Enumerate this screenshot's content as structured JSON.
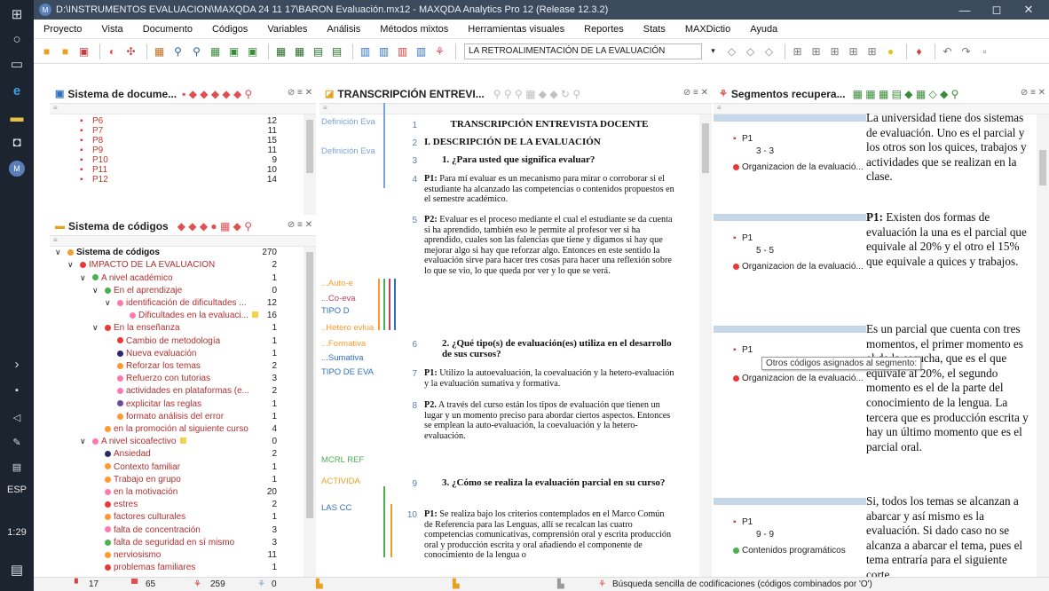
{
  "taskbar": {
    "lang": "ESP",
    "clock": "1:29"
  },
  "window": {
    "title": "D:\\INSTRUMENTOS EVALUACION\\MAXQDA 24 11 17\\BARON Evaluación.mx12 - MAXQDA Analytics Pro 12 (Release 12.3.2)"
  },
  "menu": [
    "Proyecto",
    "Vista",
    "Documento",
    "Códigos",
    "Variables",
    "Análisis",
    "Métodos mixtos",
    "Herramientas visuales",
    "Reportes",
    "Stats",
    "MAXDictio",
    "Ayuda"
  ],
  "toolbar": {
    "code_combo": "LA RETROALIMENTACIÓN DE LA EVALUACIÓN"
  },
  "doc_system": {
    "title": "Sistema de docume...",
    "rows": [
      {
        "name": "P6",
        "count": "12"
      },
      {
        "name": "P7",
        "count": "11"
      },
      {
        "name": "P8",
        "count": "15"
      },
      {
        "name": "P9",
        "count": "11"
      },
      {
        "name": "P10",
        "count": "9"
      },
      {
        "name": "P11",
        "count": "10"
      },
      {
        "name": "P12",
        "count": "14"
      }
    ]
  },
  "code_system": {
    "title": "Sistema de códigos",
    "rows": [
      {
        "label": "Sistema de códigos",
        "count": "270",
        "lvl": 0,
        "color": "#f0a030",
        "bold": true,
        "exp": "∨"
      },
      {
        "label": "IMPACTO DE LA EVALUACIÓN",
        "count": "2",
        "lvl": 1,
        "color": "#e83a3a",
        "exp": "∨",
        "red": true
      },
      {
        "label": "A nivel académico",
        "count": "1",
        "lvl": 2,
        "color": "#4caf50",
        "exp": "∨",
        "red": true
      },
      {
        "label": "En el aprendizaje",
        "count": "0",
        "lvl": 3,
        "color": "#4caf50",
        "exp": "∨",
        "red": true
      },
      {
        "label": "identificación de dificultades ...",
        "count": "12",
        "lvl": 4,
        "color": "#ff7ab0",
        "exp": "∨",
        "red": true
      },
      {
        "label": "Dificultades en la evaluaci...",
        "count": "16",
        "lvl": 5,
        "color": "#ff7ab0",
        "red": true,
        "memo": true
      },
      {
        "label": "En la enseñanza",
        "count": "1",
        "lvl": 3,
        "color": "#e83a3a",
        "exp": "∨",
        "red": true
      },
      {
        "label": "Cambio de metodología",
        "count": "1",
        "lvl": 4,
        "color": "#e83a3a",
        "red": true
      },
      {
        "label": "Nueva evaluación",
        "count": "1",
        "lvl": 4,
        "color": "#2a2a6a",
        "red": true
      },
      {
        "label": "Reforzar los temas",
        "count": "2",
        "lvl": 4,
        "color": "#ff9a30",
        "red": true
      },
      {
        "label": "Refuerzo con tutorias",
        "count": "3",
        "lvl": 4,
        "color": "#ff7ab0",
        "red": true
      },
      {
        "label": "actividades en plataformas (e...",
        "count": "2",
        "lvl": 4,
        "color": "#ff7ab0",
        "red": true
      },
      {
        "label": "explicitar las reglas",
        "count": "1",
        "lvl": 4,
        "color": "#6a4a9a",
        "red": true
      },
      {
        "label": "formato análisis del error",
        "count": "1",
        "lvl": 4,
        "color": "#ff9a30",
        "red": true
      },
      {
        "label": "en la promoción al siguiente curso",
        "count": "4",
        "lvl": 3,
        "color": "#ff9a30",
        "red": true
      },
      {
        "label": "A nivel sicoafectivo",
        "count": "0",
        "lvl": 2,
        "color": "#ff7ab0",
        "exp": "∨",
        "red": true,
        "memo": true
      },
      {
        "label": "Ansiedad",
        "count": "2",
        "lvl": 3,
        "color": "#2a2a6a",
        "red": true
      },
      {
        "label": "Contexto familiar",
        "count": "1",
        "lvl": 3,
        "color": "#ff9a30",
        "red": true
      },
      {
        "label": "Trabajo en grupo",
        "count": "1",
        "lvl": 3,
        "color": "#ff9a30",
        "red": true
      },
      {
        "label": "en la motivación",
        "count": "20",
        "lvl": 3,
        "color": "#ff7ab0",
        "red": true
      },
      {
        "label": "estres",
        "count": "2",
        "lvl": 3,
        "color": "#e83a3a",
        "red": true
      },
      {
        "label": "factores culturales",
        "count": "1",
        "lvl": 3,
        "color": "#ff9a30",
        "red": true
      },
      {
        "label": "falta de concentración",
        "count": "3",
        "lvl": 3,
        "color": "#ff7ab0",
        "red": true
      },
      {
        "label": "falta de seguridad en sí mismo",
        "count": "3",
        "lvl": 3,
        "color": "#4caf50",
        "red": true
      },
      {
        "label": "nerviosismo",
        "count": "11",
        "lvl": 3,
        "color": "#ff9a30",
        "red": true
      },
      {
        "label": "problemas familiares",
        "count": "1",
        "lvl": 3,
        "color": "#e83a3a",
        "red": true
      }
    ]
  },
  "transcript": {
    "title": "TRANSCRIPCIÓN ENTREVI...",
    "lines": [
      {
        "n": "1",
        "text": "TRANSCRIPCIÓN ENTREVISTA DOCENTE",
        "bold": true,
        "center": true
      },
      {
        "n": "2",
        "text": "I. DESCRIPCIÓN DE LA EVALUACIÓN",
        "bold": true
      },
      {
        "n": "3",
        "text": "1.  ¿Para usted que significa evaluar?",
        "bold": true,
        "indent": true
      },
      {
        "n": "4",
        "lead": "P1:",
        "text": " Para mí evaluar es un mecanismo para mirar o corroborar si el estudiante ha alcanzado las competencias o contenidos propuestos en el semestre académico."
      },
      {
        "n": "5",
        "lead": "P2:",
        "text": " Evaluar es el proceso mediante el cual el estudiante se da cuenta si ha aprendido, también eso le permite al profesor ver si ha aprendido, cuales son las falencias que tiene y digamos si hay que mejorar algo si hay que reforzar algo.  Entonces en este sentido la evaluación sirve para hacer tres cosas para hacer una reflexión sobre lo que se vio, lo que queda por ver y lo que se verá."
      },
      {
        "n": "6",
        "text": "2.  ¿Qué tipo(s) de evaluación(es) utiliza en el desarrollo de sus cursos?",
        "bold": true,
        "indent": true
      },
      {
        "n": "7",
        "lead": "P1:",
        "text": " Utilizo la autoevaluación, la coevaluación y la hetero-evaluación y la evaluación sumativa y formativa."
      },
      {
        "n": "8",
        "lead": "P2.",
        "text": " A través del curso están los tipos de evaluación que tienen un lugar y un momento preciso para abordar ciertos aspectos. Entonces se emplean la auto-evaluación, la coevaluación y la hetero-evaluación."
      },
      {
        "n": "9",
        "text": "3.  ¿Cómo se realiza la evaluación parcial en su curso?",
        "bold": true,
        "indent": true
      },
      {
        "n": "10",
        "lead": "P1:",
        "text": " Se realiza bajo los criterios contemplados en el Marco Común de Referencia para las Lenguas, allí se recalcan las cuatro competencias comunicativas, comprensión oral y escrita producción oral y producción escrita y oral añadiendo el componente de conocimiento de la lengua o"
      }
    ],
    "margin_codes": [
      "Definición Eva",
      "Definición Eva",
      "...Auto-e",
      "...Co-eva",
      "TIPO D",
      "..Hetero evlua",
      "...Formativa",
      "...Sumativa",
      "TIPO DE EVA",
      "MCRL REF",
      "ACTIVIDA",
      "LAS CC"
    ]
  },
  "segments": {
    "title": "Segmentos recupera...",
    "tooltip": "Otros códigos asignados al segmento:",
    "items": [
      {
        "doc": "P1",
        "range": "3 - 3",
        "code": "Organizacion de la evaluació...",
        "lead": "",
        "text": "La universidad tiene dos sistemas de evaluación. Uno es el parcial y los otros son los quices, trabajos y actividades que se realizan en la clase."
      },
      {
        "doc": "P1",
        "range": "5 - 5",
        "code": "Organizacion de la evaluació...",
        "lead": "P1:",
        "text": " Existen dos formas de evaluación la una es el parcial que equivale al 20% y el otro el 15% que equivale a quices y trabajos."
      },
      {
        "doc": "P1",
        "range": "",
        "code": "Organizacion de la evaluació...",
        "lead": "",
        "text": "Es un parcial que cuenta con tres momentos, el primer momento es el de la escucha, que es el que equivale al 20%, el segundo momento es el de la parte del conocimiento de la lengua. La tercera que es producción escrita y hay un último momento que es el parcial oral."
      },
      {
        "doc": "P1",
        "range": "9 - 9",
        "code": "Contenidos programáticos",
        "lead": "",
        "text": "Si, todos los temas se alcanzan a abarcar y así mismo es la evaluación. Si dado caso no se alcanza a abarcar el tema, pues el tema entraría para el siguiente corte."
      }
    ]
  },
  "status": {
    "docs": "17",
    "codes": "65",
    "segments": "259",
    "memos": "0",
    "search_mode": "Búsqueda sencilla de codificaciones (códigos combinados por 'O')"
  }
}
